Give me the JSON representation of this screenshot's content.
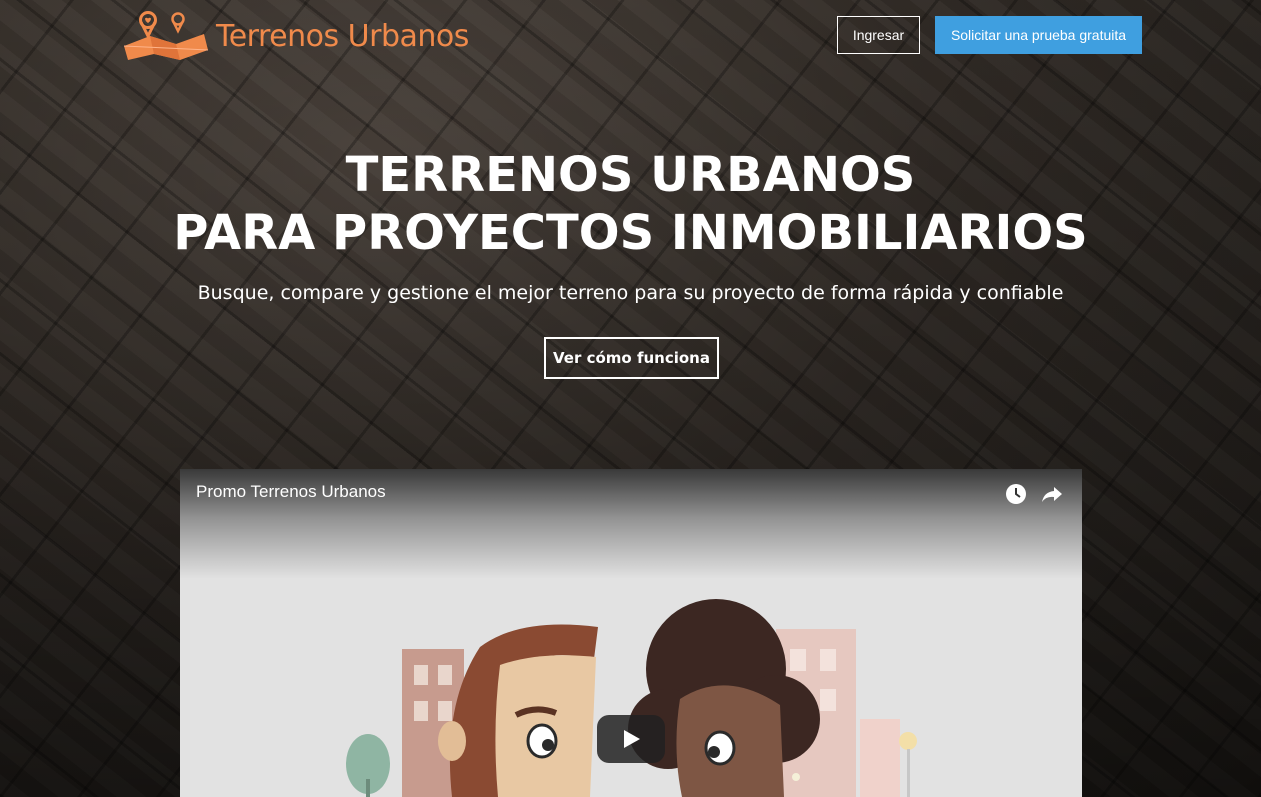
{
  "header": {
    "logo_text": "Terrenos Urbanos",
    "login_label": "Ingresar",
    "trial_label": "Solicitar una prueba gratuita"
  },
  "hero": {
    "headline_line1": "TERRENOS URBANOS",
    "headline_line2": "PARA PROYECTOS INMOBILIARIOS",
    "subtitle": "Busque, compare y gestione el mejor terreno para su proyecto de forma rápida y confiable",
    "cta_label": "Ver cómo funciona"
  },
  "video": {
    "title": "Promo Terrenos Urbanos",
    "icons": [
      "watch-later-icon",
      "share-icon",
      "play-icon"
    ]
  },
  "colors": {
    "brand_orange": "#f08a4b",
    "trial_button": "#3f9fe0",
    "text": "#ffffff"
  }
}
